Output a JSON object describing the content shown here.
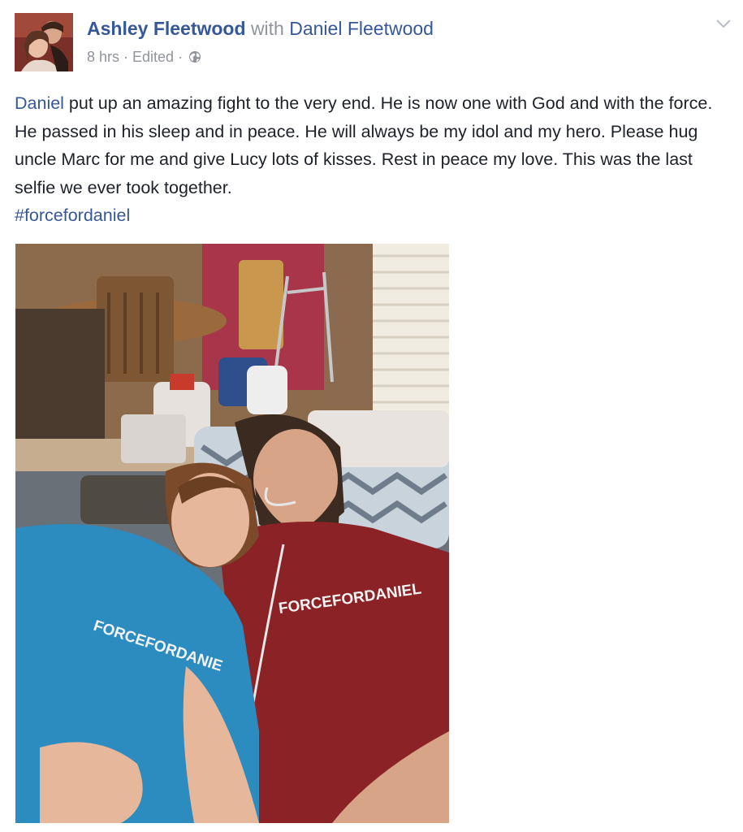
{
  "post": {
    "author": "Ashley Fleetwood",
    "with_text": "with",
    "tagged": "Daniel Fleetwood",
    "time": "8 hrs",
    "edited": "Edited",
    "separator": "·",
    "audience_icon": "globe-icon",
    "menu_icon": "chevron-down-icon",
    "text_mention": "Daniel",
    "text_body": " put up an amazing fight to the very end. He is now one with God and with the force. He passed in his sleep and in peace. He will always be my idol and my hero. Please hug uncle Marc for me and give Lucy lots of kisses. Rest in peace my love. This was the last selfie we ever took together.",
    "hashtag": "#forcefordaniel"
  },
  "photo": {
    "shirt_text_right": "FORCEFORDANIEL",
    "shirt_text_left": "FORCEFORDANIE"
  },
  "colors": {
    "link": "#365899",
    "meta": "#90949c",
    "text": "#1d2129"
  }
}
